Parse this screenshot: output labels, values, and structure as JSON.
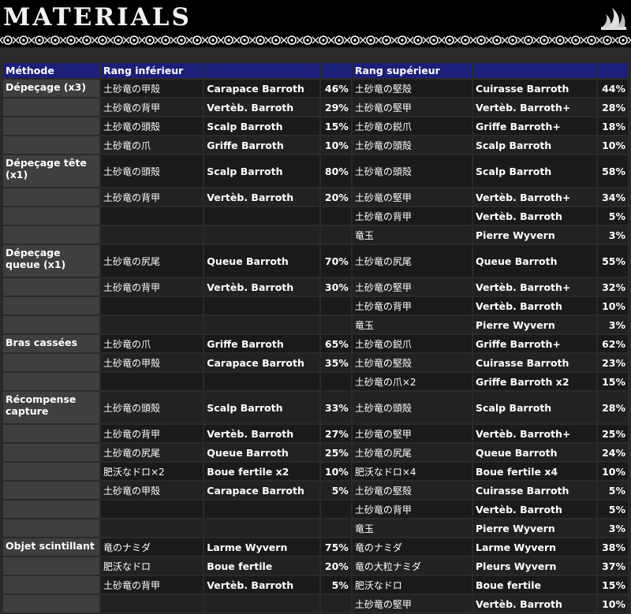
{
  "title": "MATERIALS",
  "icons": {
    "header": "wave-icon",
    "border": "ornamental-border"
  },
  "headers": [
    "Méthode",
    "Rang inférieur",
    "",
    "",
    "Rang supérieur",
    "",
    ""
  ],
  "rows": [
    {
      "method": "Dépeçage (x3)",
      "low_jp": "土砂竜の甲殻",
      "low_fr": "Carapace Barroth",
      "low_pct": "46%",
      "high_jp": "土砂竜の堅殻",
      "high_fr": "Cuirasse Barroth",
      "high_pct": "44%"
    },
    {
      "method": "",
      "low_jp": "土砂竜の背甲",
      "low_fr": "Vertèb. Barroth",
      "low_pct": "29%",
      "high_jp": "土砂竜の堅甲",
      "high_fr": "Vertèb. Barroth+",
      "high_pct": "28%"
    },
    {
      "method": "",
      "low_jp": "土砂竜の頭殻",
      "low_fr": "Scalp Barroth",
      "low_pct": "15%",
      "high_jp": "土砂竜の鋭爪",
      "high_fr": "Griffe Barroth+",
      "high_pct": "18%"
    },
    {
      "method": "",
      "low_jp": "土砂竜の爪",
      "low_fr": "Griffe Barroth",
      "low_pct": "10%",
      "high_jp": "土砂竜の頭殻",
      "high_fr": "Scalp Barroth",
      "high_pct": "10%"
    },
    {
      "method": "Dépeçage tête (x1)",
      "low_jp": "土砂竜の頭殻",
      "low_fr": "Scalp Barroth",
      "low_pct": "80%",
      "high_jp": "土砂竜の頭殻",
      "high_fr": "Scalp Barroth",
      "high_pct": "58%",
      "tall": true
    },
    {
      "method": "",
      "low_jp": "土砂竜の背甲",
      "low_fr": "Vertèb. Barroth",
      "low_pct": "20%",
      "high_jp": "土砂竜の堅甲",
      "high_fr": "Vertèb. Barroth+",
      "high_pct": "34%"
    },
    {
      "method": "",
      "low_jp": "",
      "low_fr": "",
      "low_pct": "",
      "high_jp": "土砂竜の背甲",
      "high_fr": "Vertèb. Barroth",
      "high_pct": "5%"
    },
    {
      "method": "",
      "low_jp": "",
      "low_fr": "",
      "low_pct": "",
      "high_jp": "竜玉",
      "high_fr": "Pierre Wyvern",
      "high_pct": "3%"
    },
    {
      "method": "Dépeçage queue (x1)",
      "low_jp": "土砂竜の尻尾",
      "low_fr": "Queue Barroth",
      "low_pct": "70%",
      "high_jp": "土砂竜の尻尾",
      "high_fr": "Queue Barroth",
      "high_pct": "55%",
      "tall": true
    },
    {
      "method": "",
      "low_jp": "土砂竜の背甲",
      "low_fr": "Vertèb. Barroth",
      "low_pct": "30%",
      "high_jp": "土砂竜の堅甲",
      "high_fr": "Vertèb. Barroth+",
      "high_pct": "32%"
    },
    {
      "method": "",
      "low_jp": "",
      "low_fr": "",
      "low_pct": "",
      "high_jp": "土砂竜の背甲",
      "high_fr": "Vertèb. Barroth",
      "high_pct": "10%"
    },
    {
      "method": "",
      "low_jp": "",
      "low_fr": "",
      "low_pct": "",
      "high_jp": "竜玉",
      "high_fr": "Pierre Wyvern",
      "high_pct": "3%"
    },
    {
      "method": "Bras cassées",
      "low_jp": "土砂竜の爪",
      "low_fr": "Griffe Barroth",
      "low_pct": "65%",
      "high_jp": "土砂竜の鋭爪",
      "high_fr": "Griffe Barroth+",
      "high_pct": "62%"
    },
    {
      "method": "",
      "low_jp": "土砂竜の甲殻",
      "low_fr": "Carapace Barroth",
      "low_pct": "35%",
      "high_jp": "土砂竜の堅殻",
      "high_fr": "Cuirasse Barroth",
      "high_pct": "23%"
    },
    {
      "method": "",
      "low_jp": "",
      "low_fr": "",
      "low_pct": "",
      "high_jp": "土砂竜の爪×2",
      "high_fr": "Griffe Barroth x2",
      "high_pct": "15%"
    },
    {
      "method": "Récompense capture",
      "low_jp": "土砂竜の頭殻",
      "low_fr": "Scalp Barroth",
      "low_pct": "33%",
      "high_jp": "土砂竜の頭殻",
      "high_fr": "Scalp Barroth",
      "high_pct": "28%",
      "tall": true
    },
    {
      "method": "",
      "low_jp": "土砂竜の背甲",
      "low_fr": "Vertèb. Barroth",
      "low_pct": "27%",
      "high_jp": "土砂竜の堅甲",
      "high_fr": "Vertèb. Barroth+",
      "high_pct": "25%"
    },
    {
      "method": "",
      "low_jp": "土砂竜の尻尾",
      "low_fr": "Queue Barroth",
      "low_pct": "25%",
      "high_jp": "土砂竜の尻尾",
      "high_fr": "Queue Barroth",
      "high_pct": "24%"
    },
    {
      "method": "",
      "low_jp": "肥沃なドロ×2",
      "low_fr": "Boue fertile x2",
      "low_pct": "10%",
      "high_jp": "肥沃なドロ×4",
      "high_fr": "Boue fertile x4",
      "high_pct": "10%"
    },
    {
      "method": "",
      "low_jp": "土砂竜の甲殻",
      "low_fr": "Carapace Barroth",
      "low_pct": "5%",
      "high_jp": "土砂竜の堅殻",
      "high_fr": "Cuirasse Barroth",
      "high_pct": "5%"
    },
    {
      "method": "",
      "low_jp": "",
      "low_fr": "",
      "low_pct": "",
      "high_jp": "土砂竜の背甲",
      "high_fr": "Vertèb. Barroth",
      "high_pct": "5%"
    },
    {
      "method": "",
      "low_jp": "",
      "low_fr": "",
      "low_pct": "",
      "high_jp": "竜玉",
      "high_fr": "Pierre Wyvern",
      "high_pct": "3%"
    },
    {
      "method": "Objet scintillant",
      "low_jp": "竜のナミダ",
      "low_fr": "Larme Wyvern",
      "low_pct": "75%",
      "high_jp": "竜のナミダ",
      "high_fr": "Larme Wyvern",
      "high_pct": "38%"
    },
    {
      "method": "",
      "low_jp": "肥沃なドロ",
      "low_fr": "Boue fertile",
      "low_pct": "20%",
      "high_jp": "竜の大粒ナミダ",
      "high_fr": "Pleurs Wyvern",
      "high_pct": "37%"
    },
    {
      "method": "",
      "low_jp": "土砂竜の背甲",
      "low_fr": "Vertèb. Barroth",
      "low_pct": "5%",
      "high_jp": "肥沃なドロ",
      "high_fr": "Boue fertile",
      "high_pct": "15%"
    },
    {
      "method": "",
      "low_jp": "",
      "low_fr": "",
      "low_pct": "",
      "high_jp": "土砂竜の堅甲",
      "high_fr": "Vertèb. Barroth",
      "high_pct": "10%"
    }
  ]
}
